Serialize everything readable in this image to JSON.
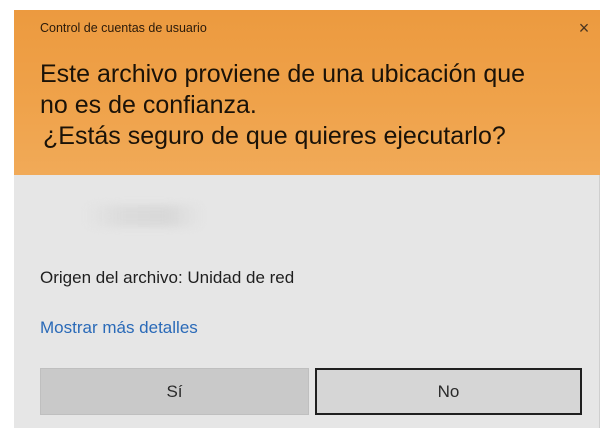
{
  "dialog": {
    "title": "Control de cuentas de usuario",
    "close_glyph": "×",
    "question_line1": "Este archivo proviene de una ubicación que",
    "question_line2": "no es de confianza.",
    "question_line3": "¿Estás seguro de que quieres ejecutarlo?",
    "origin_text": "Origen del archivo: Unidad de red",
    "details_link": "Mostrar más detalles",
    "yes_label": "Sí",
    "no_label": "No"
  },
  "colors": {
    "header_accent": "#ec9a3f",
    "body_background": "#e6e6e6",
    "link": "#2a6ab8"
  }
}
